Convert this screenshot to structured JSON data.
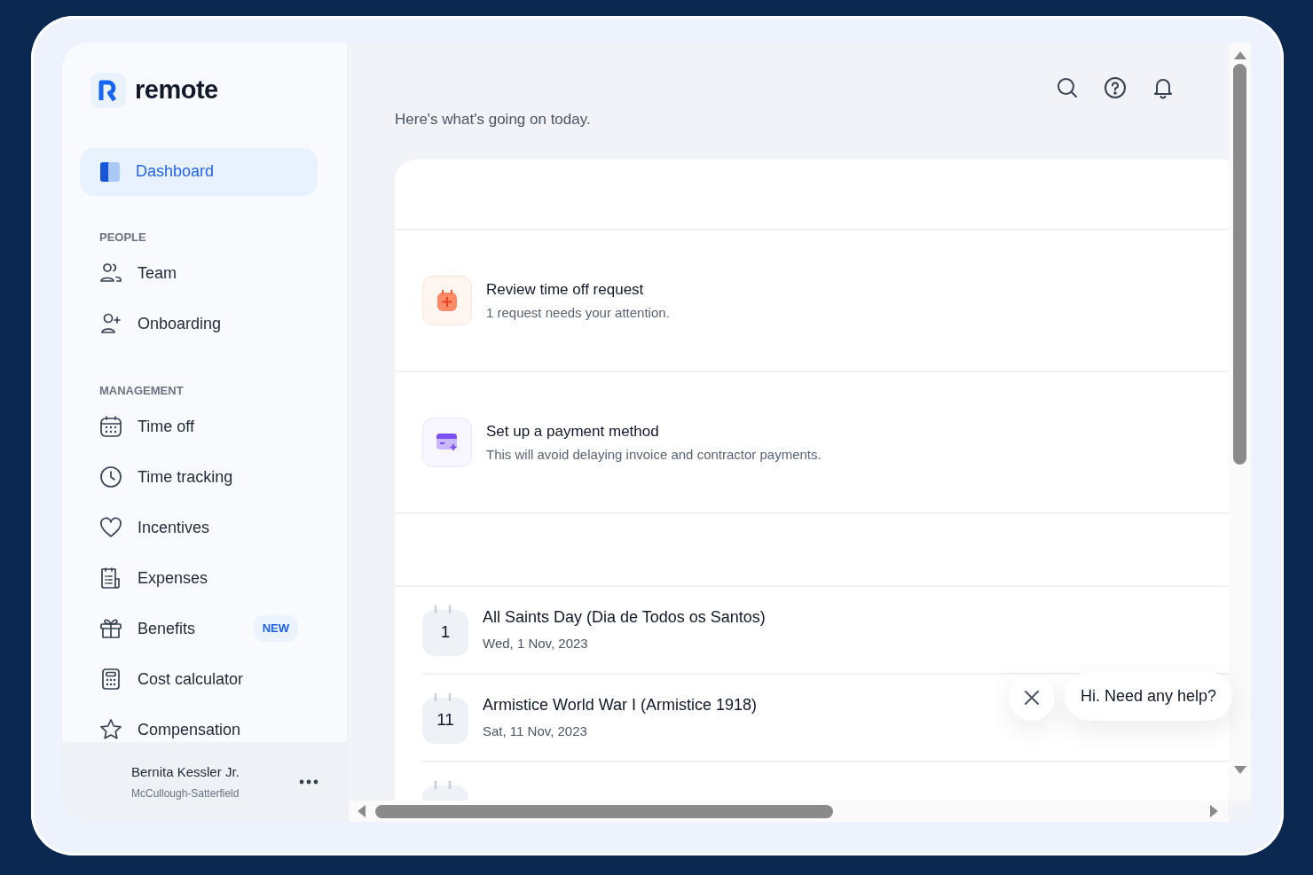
{
  "logo": {
    "text": "remote"
  },
  "sidebar": {
    "top_items": [
      {
        "label": "Dashboard",
        "selected": true
      }
    ],
    "sections": [
      {
        "heading": "PEOPLE",
        "items": [
          {
            "label": "Team",
            "selected": false
          },
          {
            "label": "Onboarding",
            "selected": false
          }
        ]
      },
      {
        "heading": "MANAGEMENT",
        "items": [
          {
            "label": "Time off",
            "selected": false
          },
          {
            "label": "Time tracking",
            "selected": false
          },
          {
            "label": "Incentives",
            "selected": false
          },
          {
            "label": "Expenses",
            "selected": false
          },
          {
            "label": "Benefits",
            "selected": false,
            "badge": "NEW"
          },
          {
            "label": "Cost calculator",
            "selected": false
          },
          {
            "label": "Compensation",
            "selected": false
          }
        ]
      }
    ]
  },
  "user": {
    "name": "Bernita Kessler Jr.",
    "company": "McCullough-Satterfield"
  },
  "subtitle": "Here's what's going on today.",
  "tasks": [
    {
      "kind": "time_off",
      "title": "Review time off request",
      "description": "1 request needs your attention."
    },
    {
      "kind": "payment",
      "title": "Set up a payment method",
      "description": "This will avoid delaying invoice and contractor payments."
    }
  ],
  "holidays": [
    {
      "day": "1",
      "title": "All Saints Day (Dia de Todos os Santos)",
      "date": "Wed, 1 Nov, 2023"
    },
    {
      "day": "11",
      "title": "Armistice World War I (Armistice 1918)",
      "date": "Sat, 11 Nov, 2023"
    }
  ],
  "chat": {
    "message": "Hi. Need any help?"
  }
}
